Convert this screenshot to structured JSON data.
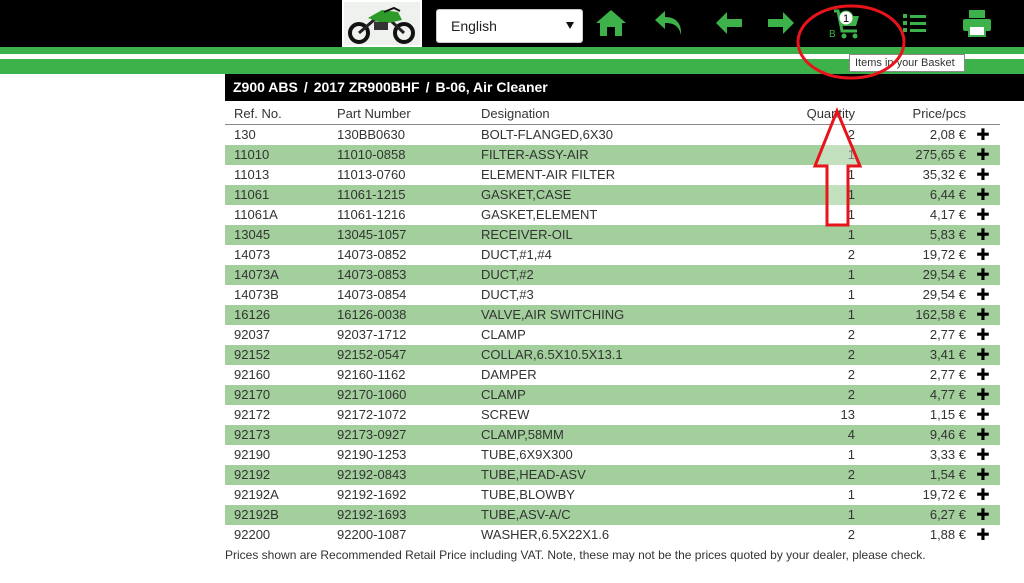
{
  "header": {
    "language": "English",
    "basket_count": "1",
    "basket_letter": "B",
    "tooltip": "Items in your Basket"
  },
  "icons": [
    "home-icon",
    "back-icon",
    "arrow-left-icon",
    "arrow-right-icon",
    "basket-icon",
    "list-icon",
    "print-icon"
  ],
  "colors": {
    "accent_green": "#3db14a",
    "row_alt": "#a3cf9d",
    "annotation_red": "#e8141c"
  },
  "breadcrumb": {
    "model": "Z900 ABS",
    "variant": "2017 ZR900BHF",
    "section": "B-06, Air Cleaner",
    "sep": "/"
  },
  "table": {
    "headers": {
      "ref": "Ref. No.",
      "part": "Part Number",
      "designation": "Designation",
      "quantity": "Quantity",
      "price": "Price/pcs"
    },
    "add_symbol": "✚",
    "rows": [
      {
        "ref": "130",
        "part": "130BB0630",
        "designation": "BOLT-FLANGED,6X30",
        "qty": "2",
        "price": "2,08 €"
      },
      {
        "ref": "11010",
        "part": "11010-0858",
        "designation": "FILTER-ASSY-AIR",
        "qty": "1",
        "price": "275,65 €"
      },
      {
        "ref": "11013",
        "part": "11013-0760",
        "designation": "ELEMENT-AIR FILTER",
        "qty": "1",
        "price": "35,32 €"
      },
      {
        "ref": "11061",
        "part": "11061-1215",
        "designation": "GASKET,CASE",
        "qty": "1",
        "price": "6,44 €"
      },
      {
        "ref": "11061A",
        "part": "11061-1216",
        "designation": "GASKET,ELEMENT",
        "qty": "1",
        "price": "4,17 €"
      },
      {
        "ref": "13045",
        "part": "13045-1057",
        "designation": "RECEIVER-OIL",
        "qty": "1",
        "price": "5,83 €"
      },
      {
        "ref": "14073",
        "part": "14073-0852",
        "designation": "DUCT,#1,#4",
        "qty": "2",
        "price": "19,72 €"
      },
      {
        "ref": "14073A",
        "part": "14073-0853",
        "designation": "DUCT,#2",
        "qty": "1",
        "price": "29,54 €"
      },
      {
        "ref": "14073B",
        "part": "14073-0854",
        "designation": "DUCT,#3",
        "qty": "1",
        "price": "29,54 €"
      },
      {
        "ref": "16126",
        "part": "16126-0038",
        "designation": "VALVE,AIR SWITCHING",
        "qty": "1",
        "price": "162,58 €"
      },
      {
        "ref": "92037",
        "part": "92037-1712",
        "designation": "CLAMP",
        "qty": "2",
        "price": "2,77 €"
      },
      {
        "ref": "92152",
        "part": "92152-0547",
        "designation": "COLLAR,6.5X10.5X13.1",
        "qty": "2",
        "price": "3,41 €"
      },
      {
        "ref": "92160",
        "part": "92160-1162",
        "designation": "DAMPER",
        "qty": "2",
        "price": "2,77 €"
      },
      {
        "ref": "92170",
        "part": "92170-1060",
        "designation": "CLAMP",
        "qty": "2",
        "price": "4,77 €"
      },
      {
        "ref": "92172",
        "part": "92172-1072",
        "designation": "SCREW",
        "qty": "13",
        "price": "1,15 €"
      },
      {
        "ref": "92173",
        "part": "92173-0927",
        "designation": "CLAMP,58MM",
        "qty": "4",
        "price": "9,46 €"
      },
      {
        "ref": "92190",
        "part": "92190-1253",
        "designation": "TUBE,6X9X300",
        "qty": "1",
        "price": "3,33 €"
      },
      {
        "ref": "92192",
        "part": "92192-0843",
        "designation": "TUBE,HEAD-ASV",
        "qty": "2",
        "price": "1,54 €"
      },
      {
        "ref": "92192A",
        "part": "92192-1692",
        "designation": "TUBE,BLOWBY",
        "qty": "1",
        "price": "19,72 €"
      },
      {
        "ref": "92192B",
        "part": "92192-1693",
        "designation": "TUBE,ASV-A/C",
        "qty": "1",
        "price": "6,27 €"
      },
      {
        "ref": "92200",
        "part": "92200-1087",
        "designation": "WASHER,6.5X22X1.6",
        "qty": "2",
        "price": "1,88 €"
      }
    ]
  },
  "footer_note": "Prices shown are Recommended Retail Price including VAT. Note, these may not be the prices quoted by your dealer, please check."
}
